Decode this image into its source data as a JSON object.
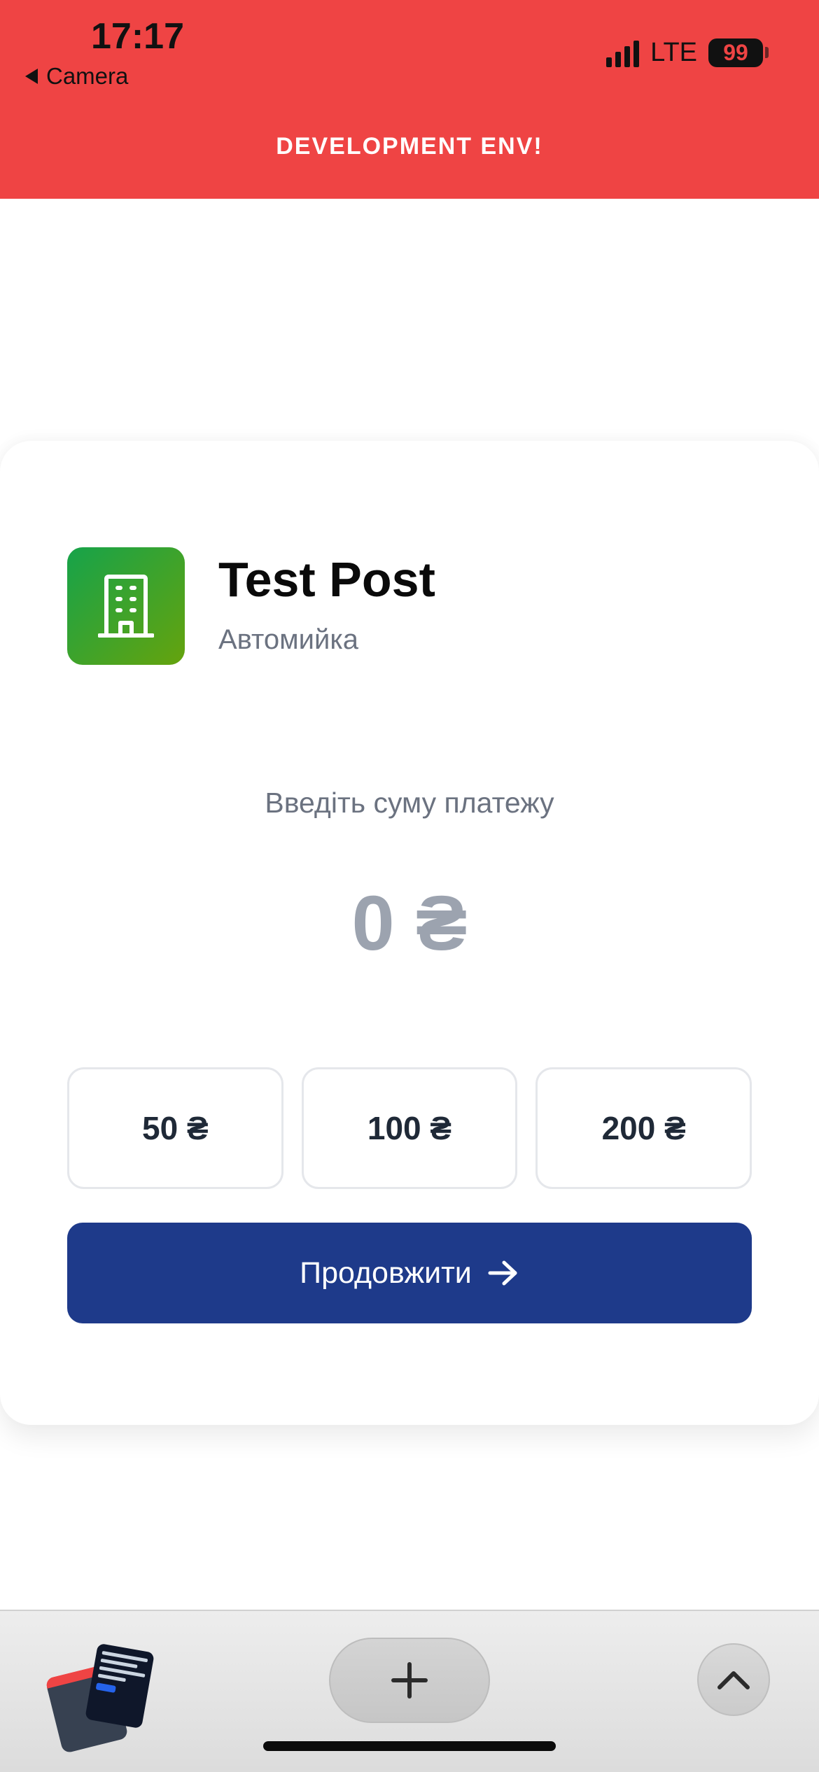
{
  "status_bar": {
    "time": "17:17",
    "back_label": "Camera",
    "network": "LTE",
    "battery": "99"
  },
  "dev_banner": "DEVELOPMENT ENV!",
  "merchant": {
    "logo_icon": "building-icon",
    "name": "Test Post",
    "type": "Автомийка"
  },
  "payment": {
    "amount_label": "Введіть суму платежу",
    "amount_value": "0 ₴",
    "presets": [
      "50 ₴",
      "100 ₴",
      "200 ₴"
    ],
    "continue_label": "Продовжити",
    "continue_icon": "arrow-right-icon"
  },
  "toolbar": {
    "tabs_icon": "tab-overview-icon",
    "new_tab_icon": "plus-icon",
    "scroll_top_icon": "chevron-up-icon"
  },
  "colors": {
    "banner": "#ef4444",
    "primary_button": "#1e3a8a",
    "logo_gradient_start": "#16a34a",
    "logo_gradient_end": "#65a30d",
    "muted_text": "#6b7280",
    "amount_placeholder": "#9ca3af"
  }
}
